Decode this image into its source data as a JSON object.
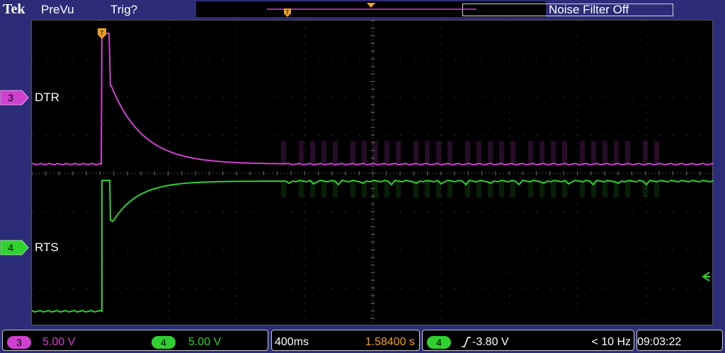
{
  "header": {
    "brand": "Tek",
    "mode": "PreVu",
    "trigger_status": "Trig?",
    "noise_filter": "Noise Filter Off"
  },
  "channels": [
    {
      "number": "3",
      "label": "DTR",
      "color": "#d040d0"
    },
    {
      "number": "4",
      "label": "RTS",
      "color": "#30d030"
    }
  ],
  "status": {
    "ch3_number": "3",
    "ch3_scale": "5.00 V",
    "ch4_number": "4",
    "ch4_scale": "5.00 V",
    "timebase": "400ms",
    "trigger_position": "1.58400 s",
    "trigger_source": "4",
    "trigger_level": "-3.80 V",
    "trigger_frequency": "< 10 Hz",
    "clock": "09:03:22"
  },
  "colors": {
    "background": "#2c2c78",
    "trigger": "#f0a020",
    "ch3": "#d040d0",
    "ch4": "#30d030"
  }
}
